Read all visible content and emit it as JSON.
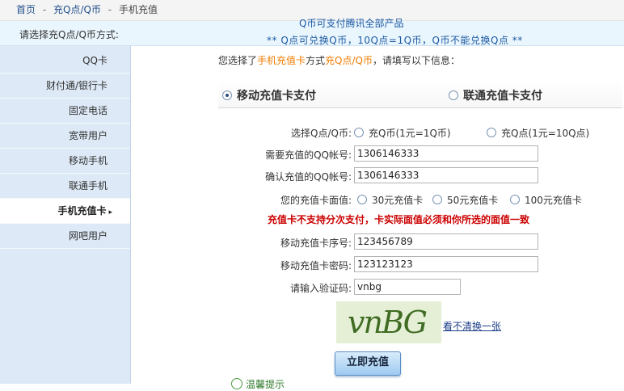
{
  "breadcrumb": {
    "home": "首页",
    "sep1": "-",
    "section": "充Q点/Q币",
    "sep2": "-",
    "current": "手机充值"
  },
  "notice": {
    "label": "请选择充Q点/Q币方式:",
    "line1": "Q币可支付腾讯全部产品",
    "line2": "** Q点可兑换Q币，10Q点=1Q币，Q币不能兑换Q点 **"
  },
  "sidebar": {
    "items": [
      {
        "label": "QQ卡"
      },
      {
        "label": "财付通/银行卡"
      },
      {
        "label": "固定电话"
      },
      {
        "label": "宽带用户"
      },
      {
        "label": "移动手机"
      },
      {
        "label": "联通手机"
      },
      {
        "label": "手机充值卡",
        "active_arrow": "▸"
      },
      {
        "label": "网吧用户"
      }
    ]
  },
  "intro": {
    "prefix": "您选择了",
    "method": "手机充值卡",
    "mid": "方式",
    "product": "充Q点/Q币",
    "suffix": "，请填写以下信息："
  },
  "pay": {
    "option1": "移动充值卡支付",
    "option2": "联通充值卡支付"
  },
  "form": {
    "select_label": "选择Q点/Q币:",
    "select_opt1": "充Q币(1元=1Q币)",
    "select_opt2": "充Q点(1元=10Q点)",
    "qq_label": "需要充值的QQ帐号:",
    "qq_value": "1306146333",
    "qq_confirm_label": "确认充值的QQ帐号:",
    "qq_confirm_value": "1306146333",
    "face_label": "您的充值卡面值:",
    "face_opt1": "30元充值卡",
    "face_opt2": "50元充值卡",
    "face_opt3": "100元充值卡",
    "warning": "充值卡不支持分次支付，卡实际面值必须和你所选的面值一致",
    "serial_label": "移动充值卡序号:",
    "serial_value": "123456789",
    "password_label": "移动充值卡密码:",
    "password_value": "123123123",
    "captcha_label": "请输入验证码:",
    "captcha_value": "vnbg",
    "captcha_image_text": "vnBG",
    "captcha_refresh": "看不清换一张",
    "submit_label": "立即充值",
    "tip": "温馨提示"
  },
  "colors": {
    "accent": "#f07c00",
    "warning": "#cc0000",
    "link": "#1f4e8c",
    "sidebar_bg": "#dde9f6"
  }
}
